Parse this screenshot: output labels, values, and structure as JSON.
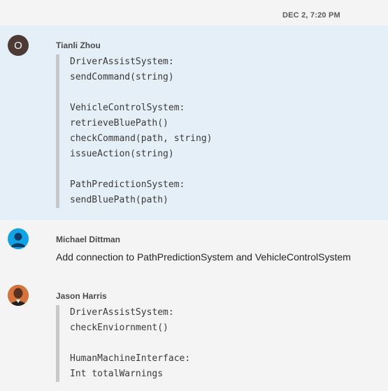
{
  "timestamp": "DEC 2, 7:20 PM",
  "messages": [
    {
      "sender": "Tianli Zhou",
      "avatar": {
        "type": "letter",
        "letter": "O",
        "color": "#4e3a35"
      },
      "quote_lines": [
        "DriverAssistSystem:",
        "sendCommand(string)",
        "",
        "VehicleControlSystem:",
        "retrieveBluePath()",
        "checkCommand(path, string)",
        "issueAction(string)",
        "",
        "PathPredictionSystem:",
        "sendBluePath(path)"
      ]
    },
    {
      "sender": "Michael Dittman",
      "avatar": {
        "type": "person-icon",
        "color": "#11a3e6"
      },
      "text": "Add connection to PathPredictionSystem and VehicleControlSystem"
    },
    {
      "sender": "Jason Harris",
      "avatar": {
        "type": "photo",
        "color": "#d4743c"
      },
      "quote_lines": [
        "DriverAssistSystem:",
        "checkEnviornment()",
        "",
        "HumanMachineInterface:",
        "Int totalWarnings"
      ]
    }
  ]
}
